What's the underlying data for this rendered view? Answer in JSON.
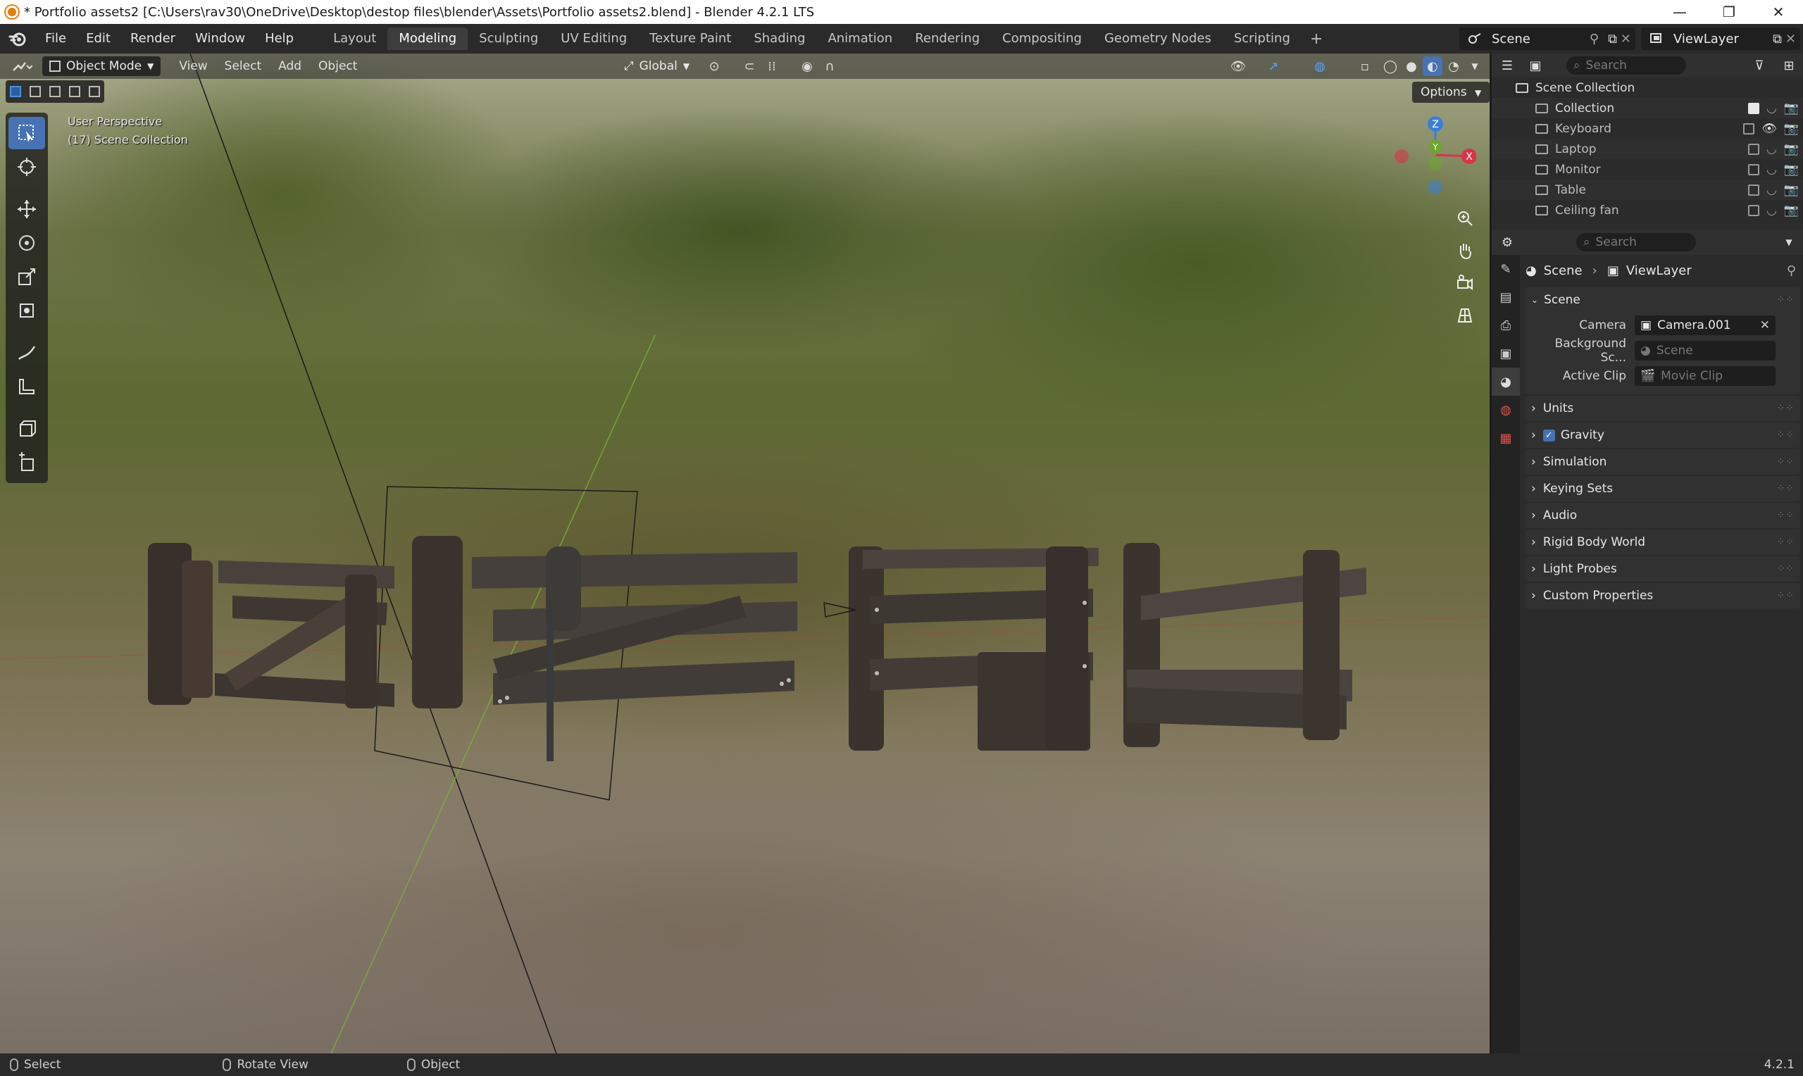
{
  "window": {
    "title": "* Portfolio assets2 [C:\\Users\\rav30\\OneDrive\\Desktop\\destop files\\blender\\Assets\\Portfolio assets2.blend] - Blender 4.2.1 LTS",
    "minimize": "—",
    "maximize": "❐",
    "close": "✕"
  },
  "menu": {
    "items": [
      "File",
      "Edit",
      "Render",
      "Window",
      "Help"
    ]
  },
  "workspaces": {
    "tabs": [
      "Layout",
      "Modeling",
      "Sculpting",
      "UV Editing",
      "Texture Paint",
      "Shading",
      "Animation",
      "Rendering",
      "Compositing",
      "Geometry Nodes",
      "Scripting"
    ],
    "active": "Modeling",
    "add": "+"
  },
  "scene_selector": {
    "value": "Scene"
  },
  "viewlayer_selector": {
    "value": "ViewLayer"
  },
  "viewport": {
    "mode": "Object Mode",
    "menus": [
      "View",
      "Select",
      "Add",
      "Object"
    ],
    "transform_orientation": "Global",
    "options_label": "Options",
    "info_line1": "User Perspective",
    "info_line2": "(17) Scene Collection",
    "gizmo": {
      "z": "Z",
      "y": "Y",
      "x": "X"
    }
  },
  "outliner": {
    "search_placeholder": "Search",
    "root": "Scene Collection",
    "items": [
      {
        "label": "Collection",
        "checked": true
      },
      {
        "label": "Keyboard",
        "checked": false
      },
      {
        "label": "Laptop",
        "checked": false
      },
      {
        "label": "Monitor",
        "checked": false
      },
      {
        "label": "Table",
        "checked": false
      },
      {
        "label": "Ceiling fan",
        "checked": false
      }
    ]
  },
  "properties": {
    "search_placeholder": "Search",
    "breadcrumb": {
      "scene": "Scene",
      "viewlayer": "ViewLayer"
    },
    "scene_panel": {
      "title": "Scene",
      "camera_label": "Camera",
      "camera_value": "Camera.001",
      "bg_label": "Background Sc...",
      "bg_placeholder": "Scene",
      "clip_label": "Active Clip",
      "clip_placeholder": "Movie Clip"
    },
    "panels": [
      "Units",
      "Gravity",
      "Simulation",
      "Keying Sets",
      "Audio",
      "Rigid Body World",
      "Light Probes",
      "Custom Properties"
    ]
  },
  "statusbar": {
    "select": "Select",
    "rotate": "Rotate View",
    "object": "Object",
    "version": "4.2.1"
  },
  "colors": {
    "accent": "#4772b3",
    "active_tab": "#3d3d3d",
    "axis_x": "#d9344a",
    "axis_y": "#6aa82a",
    "axis_z": "#3d7fd6"
  }
}
